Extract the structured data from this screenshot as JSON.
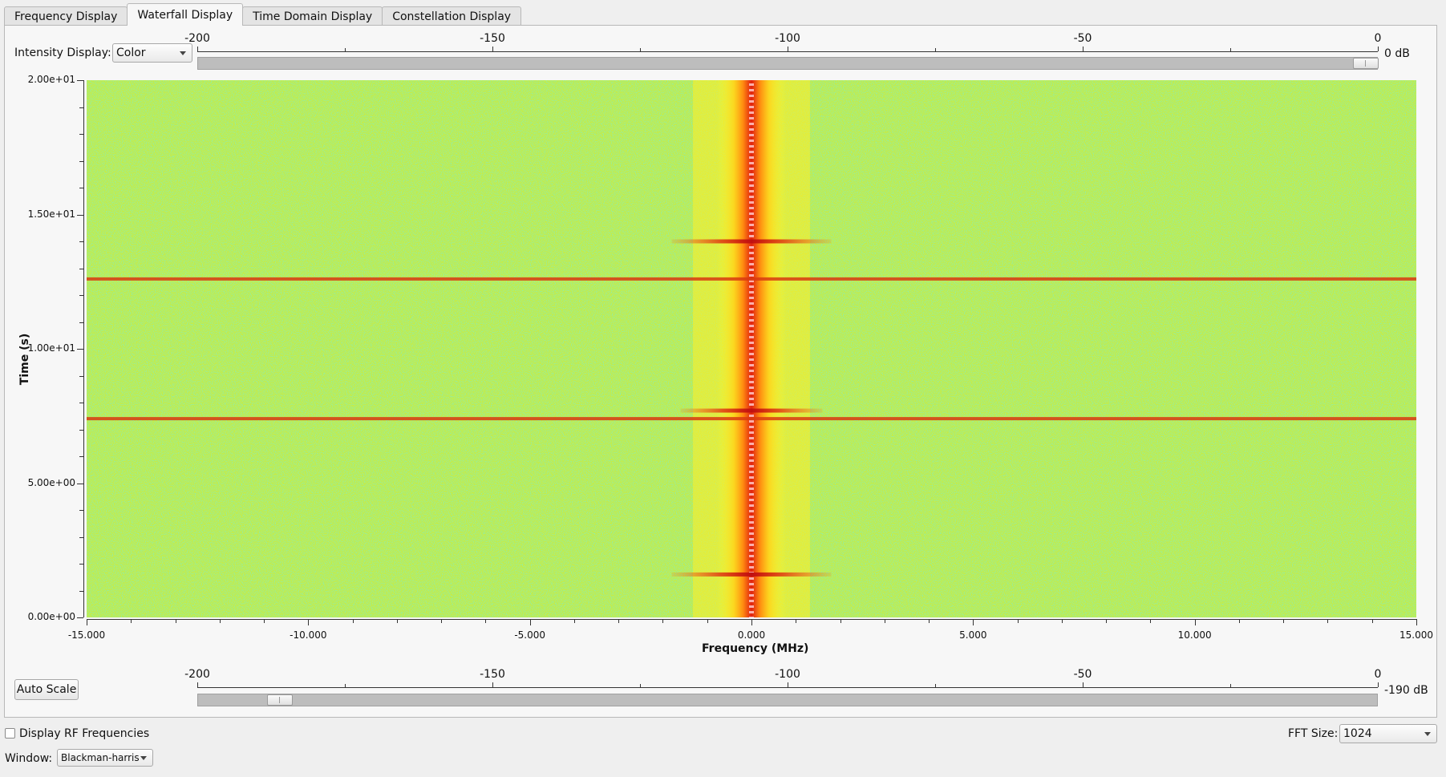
{
  "tabs": [
    {
      "label": "Frequency Display",
      "active": false
    },
    {
      "label": "Waterfall Display",
      "active": true
    },
    {
      "label": "Time Domain Display",
      "active": false
    },
    {
      "label": "Constellation Display",
      "active": false
    }
  ],
  "intensity": {
    "label": "Intensity Display:",
    "value": "Color"
  },
  "top_slider": {
    "ticks": [
      "-200",
      "-150",
      "-100",
      "-50",
      "0"
    ],
    "readout": "0 dB",
    "level_db": 0
  },
  "bottom_slider": {
    "ticks": [
      "-200",
      "-150",
      "-100",
      "-50",
      "0"
    ],
    "readout": "-190 dB",
    "level_db": -190
  },
  "auto_scale": {
    "label": "Auto Scale"
  },
  "display_rf": {
    "label": "Display RF Frequencies",
    "checked": false
  },
  "fft": {
    "label": "FFT Size:",
    "value": "1024"
  },
  "window": {
    "label": "Window:",
    "value": "Blackman-harris"
  },
  "chart_data": {
    "type": "heatmap",
    "xlabel": "Frequency (MHz)",
    "ylabel": "Time (s)",
    "xlim": [
      -15.0,
      15.0
    ],
    "ylim": [
      0.0,
      20.0
    ],
    "x_ticks": [
      "-15.000",
      "-10.000",
      "-5.000",
      "0.000",
      "5.000",
      "10.000",
      "15.000"
    ],
    "y_ticks": [
      "0.00e+00",
      "5.00e+00",
      "1.00e+01",
      "1.50e+01",
      "2.00e+01"
    ],
    "signal_center_mhz": 0.0,
    "signal_halfwidth_mhz": 0.6,
    "bursts": [
      {
        "time_s": 1.6,
        "halfwidth_mhz": 1.8
      },
      {
        "time_s": 7.4,
        "halfwidth_mhz": 15.0
      },
      {
        "time_s": 7.7,
        "halfwidth_mhz": 1.6
      },
      {
        "time_s": 12.6,
        "halfwidth_mhz": 15.0
      },
      {
        "time_s": 14.0,
        "halfwidth_mhz": 1.8
      }
    ],
    "colormap": [
      "#22c7c0",
      "#6ddf6a",
      "#c9f03a",
      "#ffff2a",
      "#ff9a12",
      "#e02010",
      "#ffd0d0"
    ]
  }
}
